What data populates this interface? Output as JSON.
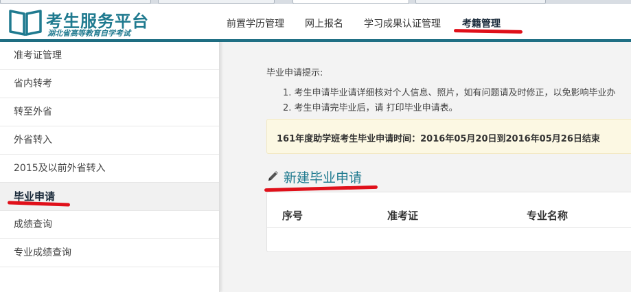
{
  "brand": {
    "title": "考生服务平台",
    "subtitle": "湖北省高等教育自学考试",
    "accent": "#1f7a8f",
    "header_bar_color": "#1f6f84"
  },
  "nav": {
    "items": [
      {
        "label": "前置学历管理"
      },
      {
        "label": "网上报名"
      },
      {
        "label": "学习成果认证管理"
      },
      {
        "label": "考籍管理",
        "active": true
      }
    ]
  },
  "sidebar": {
    "items": [
      {
        "label": "准考证管理"
      },
      {
        "label": "省内转考"
      },
      {
        "label": "转至外省"
      },
      {
        "label": "外省转入"
      },
      {
        "label": "2015及以前外省转入"
      },
      {
        "label": "毕业申请",
        "active": true
      },
      {
        "label": "成绩查询"
      },
      {
        "label": "专业成绩查询"
      }
    ]
  },
  "main": {
    "tips_title": "毕业申请提示:",
    "tips": [
      "1. 考生申请毕业请详细核对个人信息、照片，如有问题请及时修正，以免影响毕业办",
      "2. 考生申请完毕业后，请 打印毕业申请表。"
    ],
    "notice": "161年度助学班考生毕业申请时间：2016年05月20日到2016年05月26日结束",
    "notice_bg": "#fcf8e3",
    "section_title": "新建毕业申请",
    "section_icon": "pencil-icon",
    "table_headers": [
      "序号",
      "准考证",
      "专业名称"
    ]
  },
  "annotation_color": "#e0101a"
}
